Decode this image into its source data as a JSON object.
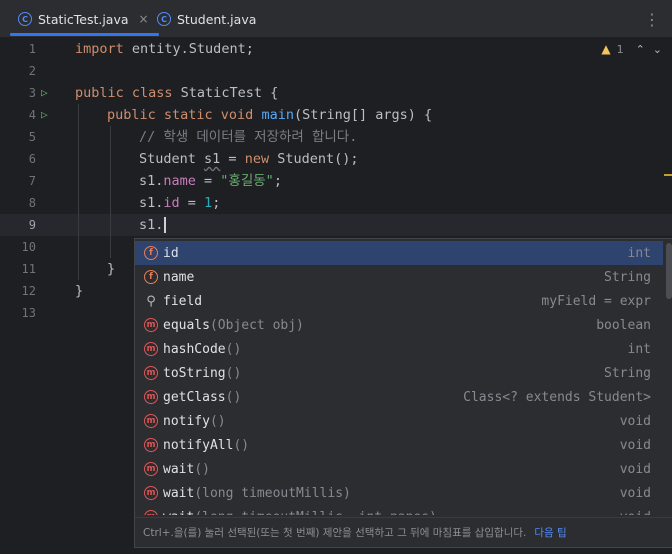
{
  "tabs": [
    {
      "label": "StaticTest.java",
      "icon": "java-class-icon",
      "active": true,
      "close": "×"
    },
    {
      "label": "Student.java",
      "icon": "java-class-icon",
      "active": false
    }
  ],
  "tab_icon_letter": "C",
  "more_menu": "⋮",
  "inspection": {
    "warning_count": "1",
    "icon": "warning-icon"
  },
  "line_numbers": [
    "1",
    "2",
    "3",
    "4",
    "5",
    "6",
    "7",
    "8",
    "9",
    "10",
    "11",
    "12",
    "13"
  ],
  "code": {
    "l1_kw": "import",
    "l1_rest": " entity.Student;",
    "l3_kw": "public class",
    "l3_rest": " StaticTest {",
    "l4_kw1": "public static void",
    "l4_fn": "main",
    "l4_rest": "(String[] args) {",
    "l5_comment": "// 학생 데이터를 저장하려 합니다.",
    "l6_a": "Student ",
    "l6_var": "s1",
    "l6_b": " = ",
    "l6_kw": "new",
    "l6_c": " Student();",
    "l7_a": "s1.",
    "l7_field": "name",
    "l7_b": " = ",
    "l7_str": "\"홍길동\"",
    "l7_c": ";",
    "l8_a": "s1.",
    "l8_field": "id",
    "l8_b": " = ",
    "l8_num": "1",
    "l8_c": ";",
    "l9_a": "s1.",
    "l11": "}",
    "l12": "}"
  },
  "completion": {
    "items": [
      {
        "icon": "f",
        "kind": "field-icon",
        "name": "id",
        "params": "",
        "type": "int"
      },
      {
        "icon": "f",
        "kind": "field-icon",
        "name": "name",
        "params": "",
        "type": "String"
      },
      {
        "icon": "⚲",
        "kind": "property-icon",
        "name": "field",
        "params": "",
        "type": "myField = expr"
      },
      {
        "icon": "m",
        "kind": "method-icon",
        "name": "equals",
        "params": "(Object obj)",
        "type": "boolean"
      },
      {
        "icon": "m",
        "kind": "method-icon",
        "name": "hashCode",
        "params": "()",
        "type": "int"
      },
      {
        "icon": "m",
        "kind": "method-icon",
        "name": "toString",
        "params": "()",
        "type": "String"
      },
      {
        "icon": "m",
        "kind": "method-icon",
        "name": "getClass",
        "params": "()",
        "type": "Class<? extends Student>"
      },
      {
        "icon": "m",
        "kind": "method-icon",
        "name": "notify",
        "params": "()",
        "type": "void"
      },
      {
        "icon": "m",
        "kind": "method-icon",
        "name": "notifyAll",
        "params": "()",
        "type": "void"
      },
      {
        "icon": "m",
        "kind": "method-icon",
        "name": "wait",
        "params": "()",
        "type": "void"
      },
      {
        "icon": "m",
        "kind": "method-icon",
        "name": "wait",
        "params": "(long timeoutMillis)",
        "type": "void"
      },
      {
        "icon": "m",
        "kind": "method-icon",
        "name": "wait",
        "params": "(long timeoutMillis, int nanos)",
        "type": "void"
      }
    ],
    "hint": "Ctrl+.을(를) 눌러 선택된(또는 첫 번째) 제안을 선택하고 그 뒤에 마침표를 삽입합니다.",
    "hint_link": "다음 팁"
  },
  "colors": {
    "accent": "#3574f0",
    "selection": "#2e436e",
    "keyword": "#cf8e6d",
    "string": "#6aab73"
  }
}
